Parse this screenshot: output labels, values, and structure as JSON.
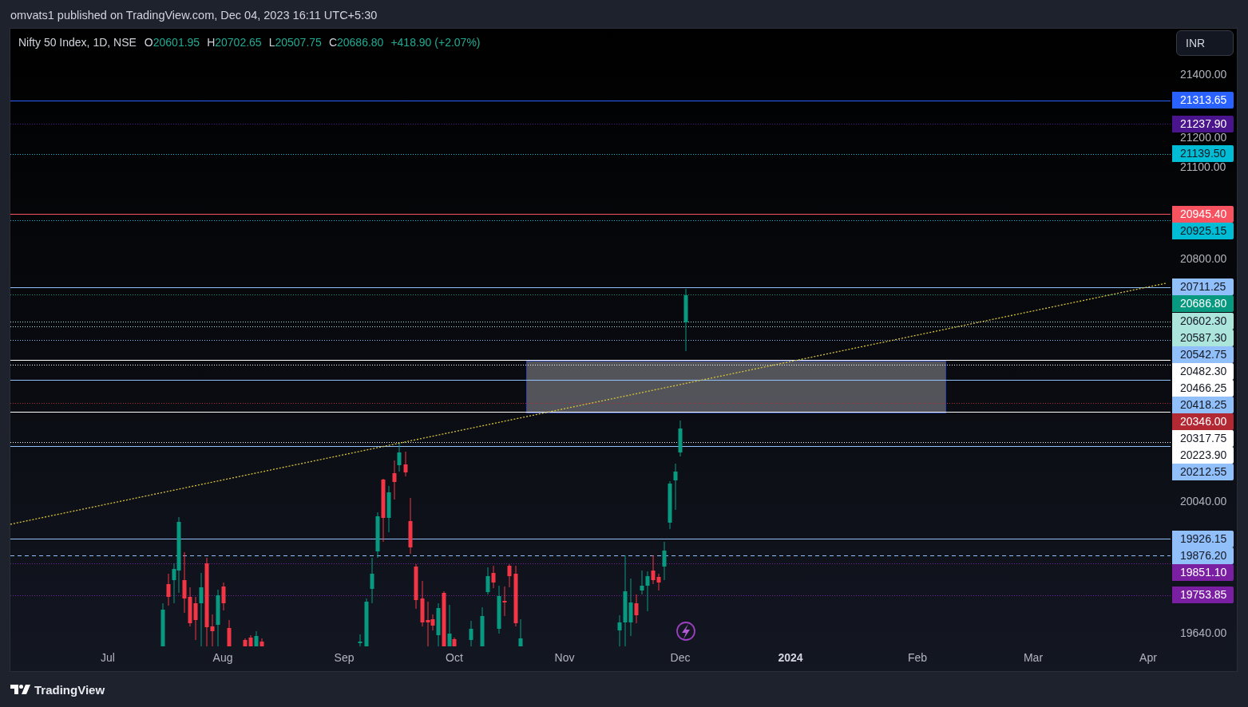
{
  "publish_info": "omvats1 published on TradingView.com, Dec 04, 2023 16:11 UTC+5:30",
  "legend": {
    "title": "Nifty 50 Index, 1D, NSE",
    "values": [
      {
        "key": "O",
        "value": "20601.95"
      },
      {
        "key": "H",
        "value": "20702.65"
      },
      {
        "key": "L",
        "value": "20507.75"
      },
      {
        "key": "C",
        "value": "20686.80"
      }
    ],
    "change": "+418.90 (+2.07%)"
  },
  "currency_button": {
    "label": "INR"
  },
  "price_ticks": [
    "21400.00",
    "21200.00",
    "21100.00",
    "20800.00",
    "20040.00",
    "19640.00"
  ],
  "price_levels": [
    {
      "label": "21313.65",
      "color": "#2962ff",
      "kind": "solid"
    },
    {
      "label": "21237.90",
      "color": "#4a148c",
      "kind": "dotted"
    },
    {
      "label": "21139.50",
      "color": "#00bcd4",
      "kind": "dotted"
    },
    {
      "label": "20945.40",
      "color": "#f7525f",
      "kind": "solid"
    },
    {
      "label": "20925.15",
      "color": "#00bcd4",
      "kind": "dotted"
    },
    {
      "label": "20711.25",
      "color": "#90bff9",
      "kind": "solid"
    },
    {
      "label": "20686.80",
      "color": "#089981",
      "kind": "dotted"
    },
    {
      "label": "20602.30",
      "color": "#ace5dc",
      "kind": "dotted"
    },
    {
      "label": "20587.30",
      "color": "#ace5dc",
      "kind": "dotted"
    },
    {
      "label": "20542.75",
      "color": "#90bff9",
      "kind": "dotted"
    },
    {
      "label": "20482.30",
      "color": "#ffffff",
      "kind": "solid"
    },
    {
      "label": "20466.25",
      "color": "#ffffff",
      "kind": "dotted"
    },
    {
      "label": "20418.25",
      "color": "#90bff9",
      "kind": "solid"
    },
    {
      "label": "20346.00",
      "color": "#b22833",
      "kind": "dotted"
    },
    {
      "label": "20317.75",
      "color": "#ffffff",
      "kind": "solid"
    },
    {
      "label": "20223.90",
      "color": "#ffffff",
      "kind": "dotted"
    },
    {
      "label": "20212.55",
      "color": "#90bff9",
      "kind": "solid"
    },
    {
      "label": "19926.15",
      "color": "#90bff9",
      "kind": "solid"
    },
    {
      "label": "19876.20",
      "color": "#90bff9",
      "kind": "dashed"
    },
    {
      "label": "19851.10",
      "color": "#7b1fa2",
      "kind": "dotted"
    },
    {
      "label": "19753.85",
      "color": "#7b1fa2",
      "kind": "dotted"
    }
  ],
  "time_axis": [
    {
      "label": "Jul",
      "kind": "month"
    },
    {
      "label": "Aug",
      "kind": "month"
    },
    {
      "label": "Sep",
      "kind": "month"
    },
    {
      "label": "Oct",
      "kind": "month"
    },
    {
      "label": "Nov",
      "kind": "month"
    },
    {
      "label": "Dec",
      "kind": "month"
    },
    {
      "label": "2024",
      "kind": "year"
    },
    {
      "label": "Feb",
      "kind": "month"
    },
    {
      "label": "Mar",
      "kind": "month"
    },
    {
      "label": "Apr",
      "kind": "month"
    }
  ],
  "footer": {
    "brand": "TradingView"
  }
}
